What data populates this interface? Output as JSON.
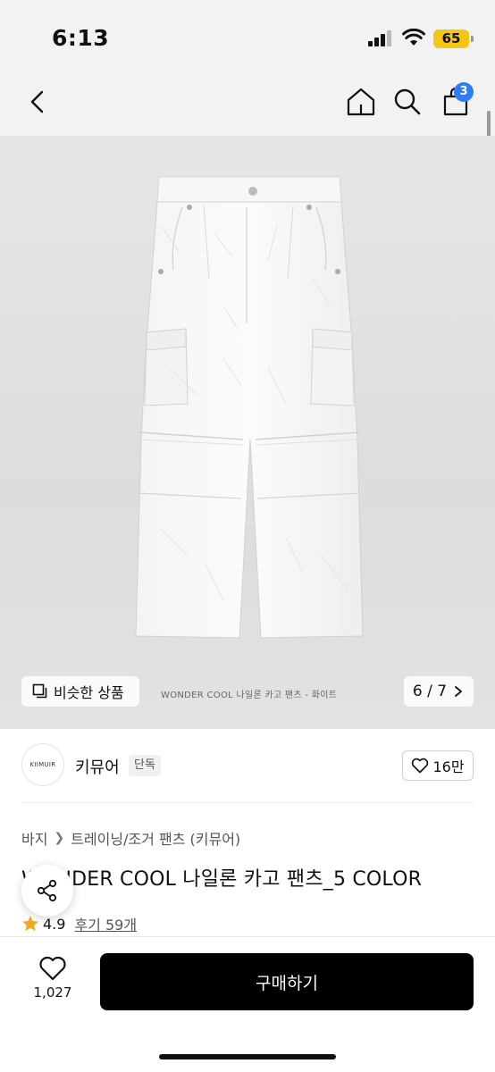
{
  "status": {
    "time": "6:13",
    "battery": "65"
  },
  "nav": {
    "cart_count": "3"
  },
  "image": {
    "similar_label": "비슷한 상품",
    "caption": "WONDER COOL 나일론 카고 팬츠 - 화이트",
    "pager": "6 / 7"
  },
  "brand": {
    "logo_text": "KIIMUIR",
    "name": "키뮤어",
    "badge": "단독",
    "likes": "16만"
  },
  "breadcrumb": [
    "바지",
    "트레이닝/조거 팬츠 (키뮤어)"
  ],
  "product": {
    "title": "WONDER COOL 나일론 카고 팬츠_5 COLOR",
    "rating": "4.9",
    "reviews": "후기 59개"
  },
  "bottom": {
    "wish_count": "1,027",
    "buy_label": "구매하기"
  },
  "colors": {
    "accent_badge": "#2f7cf6",
    "star": "#f5a623",
    "buy_bg": "#000000"
  }
}
